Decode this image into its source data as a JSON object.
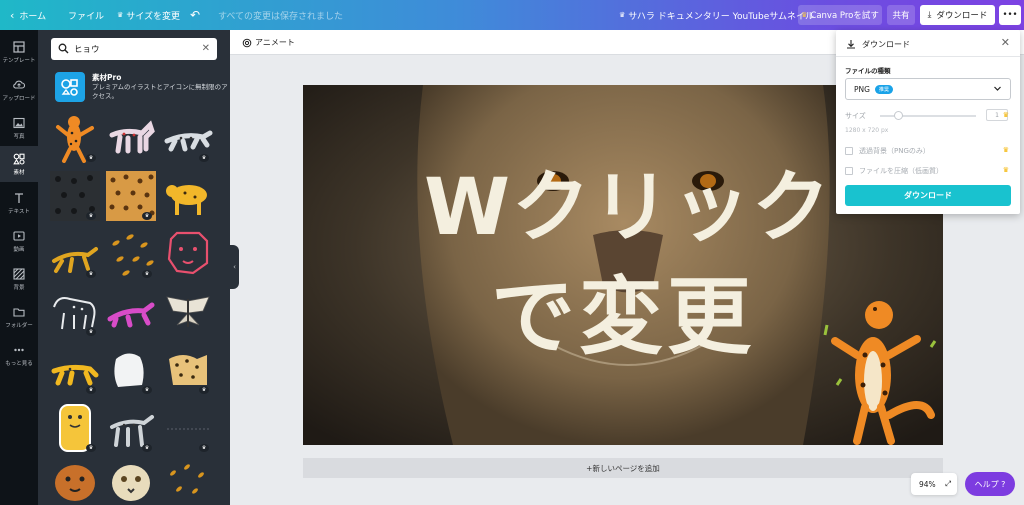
{
  "topbar": {
    "home": "ホーム",
    "file": "ファイル",
    "resize": "サイズを変更",
    "saved_status": "すべての変更は保存されました",
    "doc_title": "サハラ ドキュメンタリー YouTubeサムネイル",
    "pro_button": "Canva Proを試す",
    "share_button": "共有",
    "download_button": "ダウンロード",
    "more_button": "•••"
  },
  "rail": {
    "items": [
      {
        "label": "テンプレート",
        "icon": "template-icon"
      },
      {
        "label": "アップロード",
        "icon": "upload-icon"
      },
      {
        "label": "写真",
        "icon": "photo-icon"
      },
      {
        "label": "素材",
        "icon": "elements-icon"
      },
      {
        "label": "テキスト",
        "icon": "text-icon"
      },
      {
        "label": "動画",
        "icon": "video-icon"
      },
      {
        "label": "背景",
        "icon": "background-icon"
      },
      {
        "label": "フォルダー",
        "icon": "folder-icon"
      },
      {
        "label": "もっと見る",
        "icon": "more-icon"
      }
    ],
    "active_index": 3
  },
  "panel": {
    "search_value": "ヒョウ",
    "promo_title": "素材Pro",
    "promo_desc": "プレミアムのイラストとアイコンに無制限のアクセス。"
  },
  "editor": {
    "animate": "アニメート",
    "canvas_text_line1": "Wクリック",
    "canvas_text_line2": "で変更",
    "add_page": "+新しいページを追加",
    "zoom": "94%",
    "help": "ヘルプ ?"
  },
  "download_dialog": {
    "title": "ダウンロード",
    "file_type_label": "ファイルの種類",
    "file_type_value": "PNG",
    "file_type_badge": "推奨",
    "size_label": "サイズ",
    "size_value": "1",
    "dimensions": "1280 x 720 px",
    "transparent_label": "透過背景（PNGのみ）",
    "compress_label": "ファイルを圧縮（低画質）",
    "download_button": "ダウンロード"
  },
  "colors": {
    "accent": "#19c2cf",
    "help_purple": "#7d3ce0",
    "panel_bg": "#293039",
    "rail_bg": "#0e1318",
    "canvas_text": "#f4efdf"
  }
}
